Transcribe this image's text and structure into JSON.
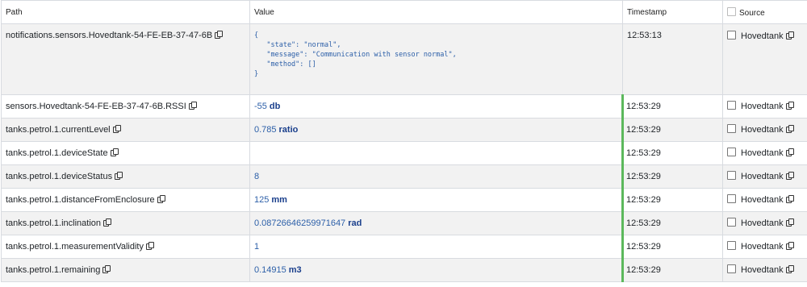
{
  "columns": {
    "path": "Path",
    "value": "Value",
    "timestamp": "Timestamp",
    "source": "Source"
  },
  "rows": [
    {
      "path": "notifications.sensors.Hovedtank-54-FE-EB-37-47-6B",
      "json": "{\n   \"state\": \"normal\",\n   \"message\": \"Communication with sensor normal\",\n   \"method\": []\n}",
      "timestamp": "12:53:13",
      "source": "Hovedtank"
    },
    {
      "path": "sensors.Hovedtank-54-FE-EB-37-47-6B.RSSI",
      "value": "-55",
      "unit": "db",
      "timestamp": "12:53:29",
      "source": "Hovedtank"
    },
    {
      "path": "tanks.petrol.1.currentLevel",
      "value": "0.785",
      "unit": "ratio",
      "timestamp": "12:53:29",
      "source": "Hovedtank"
    },
    {
      "path": "tanks.petrol.1.deviceState",
      "value": "",
      "unit": "",
      "timestamp": "12:53:29",
      "source": "Hovedtank"
    },
    {
      "path": "tanks.petrol.1.deviceStatus",
      "value": "8",
      "unit": "",
      "timestamp": "12:53:29",
      "source": "Hovedtank"
    },
    {
      "path": "tanks.petrol.1.distanceFromEnclosure",
      "value": "125",
      "unit": "mm",
      "timestamp": "12:53:29",
      "source": "Hovedtank"
    },
    {
      "path": "tanks.petrol.1.inclination",
      "value": "0.08726646259971647",
      "unit": "rad",
      "timestamp": "12:53:29",
      "source": "Hovedtank"
    },
    {
      "path": "tanks.petrol.1.measurementValidity",
      "value": "1",
      "unit": "",
      "timestamp": "12:53:29",
      "source": "Hovedtank"
    },
    {
      "path": "tanks.petrol.1.remaining",
      "value": "0.14915",
      "unit": "m3",
      "timestamp": "12:53:29",
      "source": "Hovedtank"
    }
  ],
  "colors": {
    "value_text": "#2c5fa8",
    "unit_text": "#1a3f8c",
    "live_indicator": "#5cb85c",
    "stripe": "#f2f2f2",
    "border": "#d8dbe0"
  }
}
